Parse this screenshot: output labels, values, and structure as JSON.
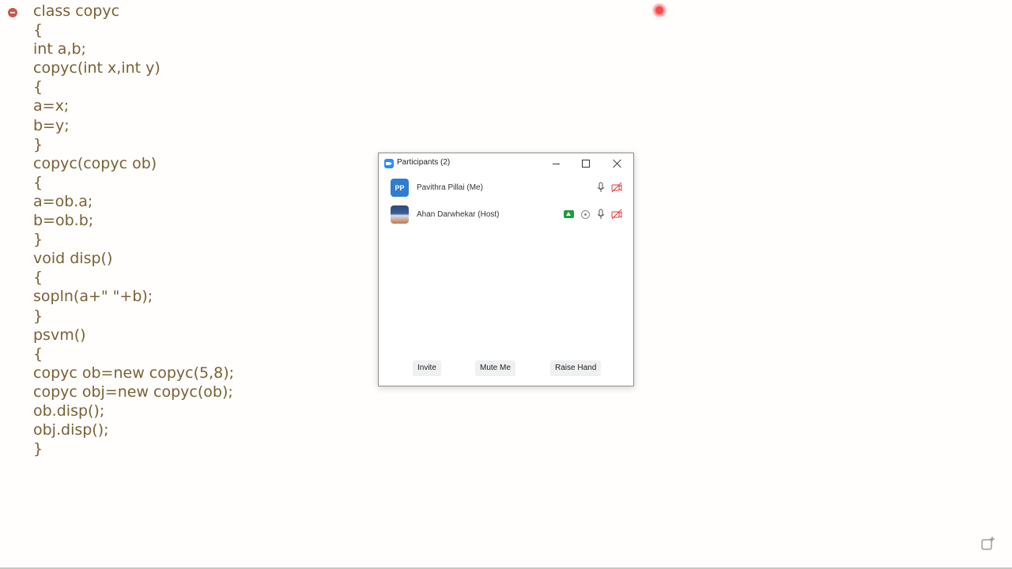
{
  "code": {
    "lines": [
      "class copyc",
      "{",
      "int a,b;",
      "copyc(int x,int y)",
      "{",
      "a=x;",
      "b=y;",
      "}",
      "copyc(copyc ob)",
      "{",
      "a=ob.a;",
      "b=ob.b;",
      "}",
      "void disp()",
      "{",
      "sopln(a+\" \"+b);",
      "}",
      "psvm()",
      "{",
      "copyc ob=new copyc(5,8);",
      "copyc obj=new copyc(ob);",
      "ob.disp();",
      "obj.disp();",
      "}"
    ]
  },
  "participants_window": {
    "title": "Participants (2)",
    "participants": [
      {
        "name": "Pavithra Pillai (Me)",
        "avatar_initials": "PP",
        "avatar_color": "#2e7dd1",
        "icons": [
          "microphone-icon",
          "video-off-icon"
        ]
      },
      {
        "name": "Ahan Darwhekar (Host)",
        "avatar_type": "photo",
        "icons": [
          "screen-share-icon",
          "recording-icon",
          "microphone-icon",
          "video-off-icon"
        ]
      }
    ],
    "buttons": {
      "invite": "Invite",
      "mute_me": "Mute Me",
      "raise_hand": "Raise Hand"
    }
  },
  "colors": {
    "code_text": "#7a6034",
    "background": "#fffefc",
    "video_off": "#e0393e",
    "screen_share": "#1e9b3c",
    "recording": "#ff4a4a"
  }
}
